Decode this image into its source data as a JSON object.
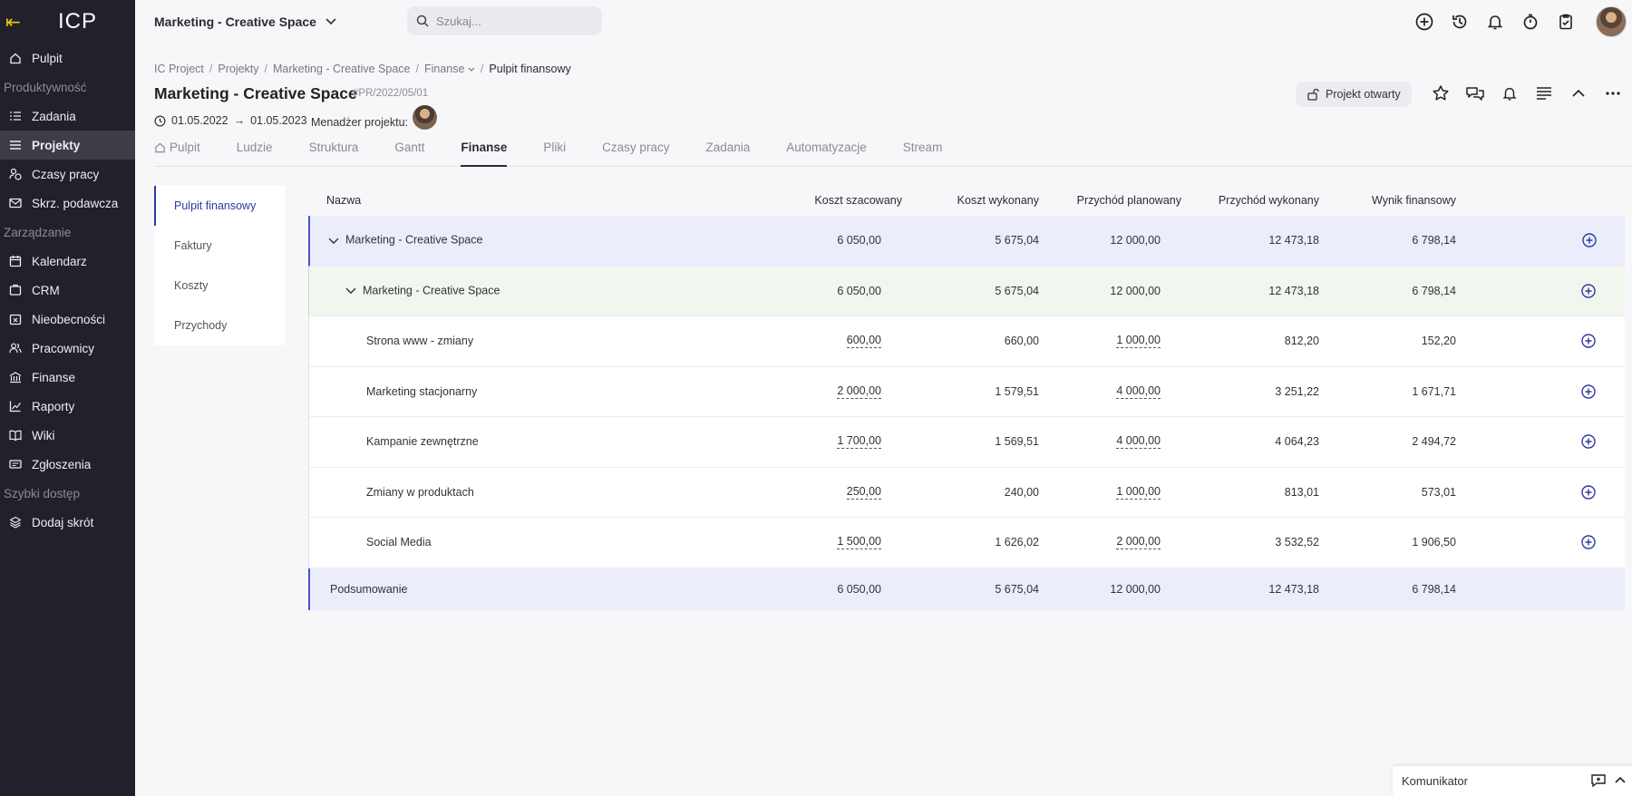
{
  "sidebar": {
    "logo": "ICP",
    "items": [
      {
        "type": "item",
        "label": "Pulpit",
        "icon": "home-icon"
      },
      {
        "type": "section",
        "label": "Produktywność"
      },
      {
        "type": "item",
        "label": "Zadania",
        "icon": "tasks-icon"
      },
      {
        "type": "item",
        "label": "Projekty",
        "icon": "projects-icon",
        "active": true
      },
      {
        "type": "item",
        "label": "Czasy pracy",
        "icon": "worktime-icon"
      },
      {
        "type": "item",
        "label": "Skrz. podawcza",
        "icon": "mail-icon"
      },
      {
        "type": "section",
        "label": "Zarządzanie"
      },
      {
        "type": "item",
        "label": "Kalendarz",
        "icon": "calendar-icon"
      },
      {
        "type": "item",
        "label": "CRM",
        "icon": "crm-icon"
      },
      {
        "type": "item",
        "label": "Nieobecności",
        "icon": "absence-icon"
      },
      {
        "type": "item",
        "label": "Pracownicy",
        "icon": "people-icon"
      },
      {
        "type": "item",
        "label": "Finanse",
        "icon": "finance-icon"
      },
      {
        "type": "item",
        "label": "Raporty",
        "icon": "reports-icon"
      },
      {
        "type": "item",
        "label": "Wiki",
        "icon": "wiki-icon"
      },
      {
        "type": "item",
        "label": "Zgłoszenia",
        "icon": "tickets-icon"
      },
      {
        "type": "section",
        "label": "Szybki dostęp"
      },
      {
        "type": "item",
        "label": "Dodaj skrót",
        "icon": "add-shortcut-icon"
      }
    ]
  },
  "topbar": {
    "project_name": "Marketing - Creative Space",
    "search_placeholder": "Szukaj..."
  },
  "header": {
    "breadcrumb": [
      "IC Project",
      "Projekty",
      "Marketing - Creative Space",
      "Finanse",
      "Pulpit finansowy"
    ],
    "title": "Marketing - Creative Space",
    "code": "#PR/2022/05/01",
    "date_start": "01.05.2022",
    "date_end": "01.05.2023",
    "manager_label": "Menadżer projektu:",
    "status": "Projekt otwarty"
  },
  "tabs": [
    {
      "label": "Pulpit",
      "icon": "home-icon"
    },
    {
      "label": "Ludzie"
    },
    {
      "label": "Struktura"
    },
    {
      "label": "Gantt"
    },
    {
      "label": "Finanse",
      "active": true
    },
    {
      "label": "Pliki"
    },
    {
      "label": "Czasy pracy"
    },
    {
      "label": "Zadania"
    },
    {
      "label": "Automatyzacje"
    },
    {
      "label": "Stream"
    }
  ],
  "side_menu": [
    {
      "label": "Pulpit finansowy",
      "active": true
    },
    {
      "label": "Faktury"
    },
    {
      "label": "Koszty"
    },
    {
      "label": "Przychody"
    }
  ],
  "table": {
    "columns": [
      "Nazwa",
      "Koszt szacowany",
      "Koszt wykonany",
      "Przychód planowany",
      "Przychód wykonany",
      "Wynik finansowy"
    ],
    "rows": [
      {
        "level": 0,
        "name": "Marketing - Creative Space",
        "est": "6 050,00",
        "cost": "5 675,04",
        "plan": "12 000,00",
        "income": "12 473,18",
        "result": "6 798,14"
      },
      {
        "level": 1,
        "name": "Marketing - Creative Space",
        "est": "6 050,00",
        "cost": "5 675,04",
        "plan": "12 000,00",
        "income": "12 473,18",
        "result": "6 798,14"
      },
      {
        "level": 2,
        "name": "Strona www - zmiany",
        "est": "600,00",
        "cost": "660,00",
        "plan": "1 000,00",
        "income": "812,20",
        "result": "152,20"
      },
      {
        "level": 2,
        "name": "Marketing stacjonarny",
        "est": "2 000,00",
        "cost": "1 579,51",
        "plan": "4 000,00",
        "income": "3 251,22",
        "result": "1 671,71"
      },
      {
        "level": 2,
        "name": "Kampanie zewnętrzne",
        "est": "1 700,00",
        "cost": "1 569,51",
        "plan": "4 000,00",
        "income": "4 064,23",
        "result": "2 494,72"
      },
      {
        "level": 2,
        "name": "Zmiany w produktach",
        "est": "250,00",
        "cost": "240,00",
        "plan": "1 000,00",
        "income": "813,01",
        "result": "573,01"
      },
      {
        "level": 2,
        "name": "Social Media",
        "est": "1 500,00",
        "cost": "1 626,02",
        "plan": "2 000,00",
        "income": "3 532,52",
        "result": "1 906,50"
      }
    ],
    "summary": {
      "name": "Podsumowanie",
      "est": "6 050,00",
      "cost": "5 675,04",
      "plan": "12 000,00",
      "income": "12 473,18",
      "result": "6 798,14"
    }
  },
  "chat": {
    "label": "Komunikator"
  },
  "colors": {
    "sidebar_bg": "#21212b",
    "accent": "#2d3aa0",
    "logo_arrow": "#f0c419"
  }
}
